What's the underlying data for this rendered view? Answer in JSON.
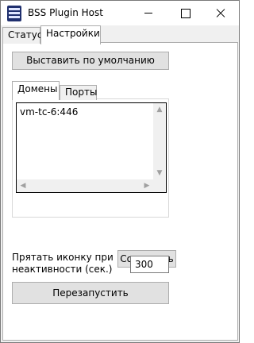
{
  "window": {
    "title": "BSS Plugin Host"
  },
  "main_tabs": [
    {
      "label": "Статус",
      "active": false
    },
    {
      "label": "Настройки",
      "active": true
    }
  ],
  "settings": {
    "default_button": "Выставить по умолчанию",
    "inner_tabs": [
      {
        "label": "Домены",
        "active": true
      },
      {
        "label": "Порты",
        "active": false
      }
    ],
    "domains": [
      "vm-tc-6:446"
    ],
    "save_button": "Сохранить",
    "hide_icon_label": "Прятать иконку при неактивности (сек.)",
    "hide_icon_value": "300",
    "restart_button": "Перезапустить"
  },
  "icons": {
    "app": "bss-app-icon",
    "minimize": "minimize-icon",
    "maximize": "maximize-icon",
    "close": "close-icon"
  }
}
